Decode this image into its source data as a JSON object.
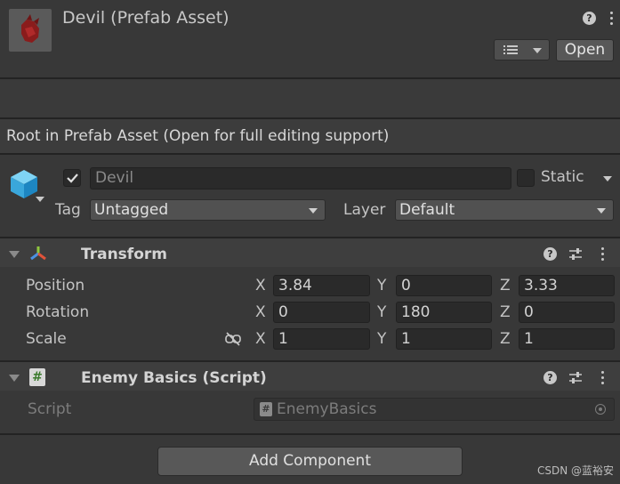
{
  "header": {
    "title": "Devil (Prefab Asset)",
    "open_label": "Open"
  },
  "banner": {
    "text": "Root in Prefab Asset (Open for full editing support)"
  },
  "object": {
    "active_checked": true,
    "name": "Devil",
    "static_label": "Static",
    "tag_label": "Tag",
    "tag_value": "Untagged",
    "layer_label": "Layer",
    "layer_value": "Default"
  },
  "transform": {
    "title": "Transform",
    "rows": [
      {
        "label": "Position",
        "x": "3.84",
        "y": "0",
        "z": "3.33"
      },
      {
        "label": "Rotation",
        "x": "0",
        "y": "180",
        "z": "0"
      },
      {
        "label": "Scale",
        "x": "1",
        "y": "1",
        "z": "1"
      }
    ],
    "axis_x": "X",
    "axis_y": "Y",
    "axis_z": "Z"
  },
  "enemy_basics": {
    "title": "Enemy Basics (Script)",
    "script_label": "Script",
    "script_value": "EnemyBasics"
  },
  "add_component_label": "Add Component",
  "watermark": "CSDN @蓝裕安"
}
